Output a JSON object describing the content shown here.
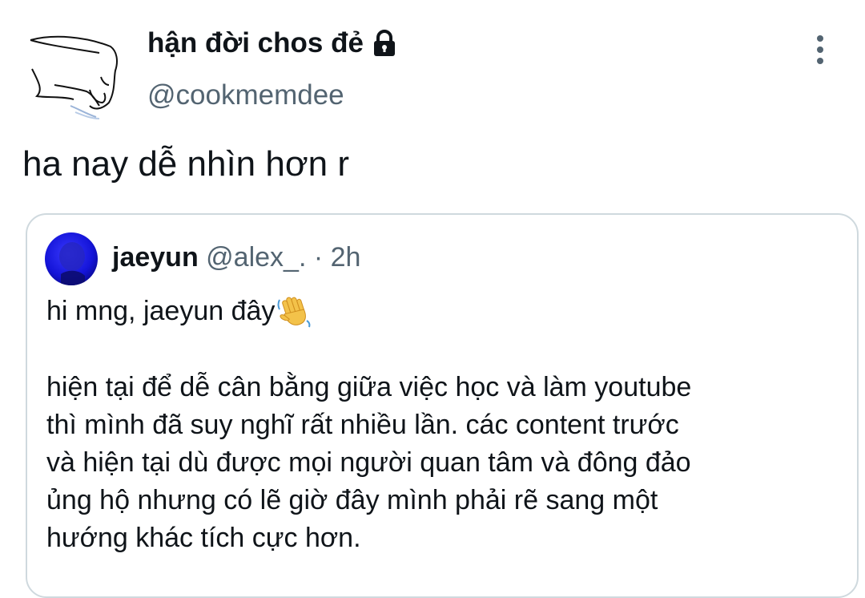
{
  "author": {
    "display_name": "hận đời chos đẻ",
    "handle": "@cookmemdee",
    "avatar_icon": "sketch-drawing-avatar",
    "protected_icon": "lock-icon"
  },
  "more_icon": "vertical-ellipsis-icon",
  "tweet": {
    "text": "ha nay dễ nhìn hơn r"
  },
  "quoted": {
    "name": "jaeyun",
    "meta": " @alex_. · 2h",
    "avatar_icon": "blue-photo-avatar",
    "greeting": "hi mng, jaeyun đây",
    "greeting_icon": "waving-hand-emoji",
    "body_lines": [
      "hiện tại để dễ cân bằng giữa việc học và làm youtube",
      "thì mình đã suy nghĩ rất nhiều lần. các content trước",
      "và hiện tại dù được mọi người quan tâm và đông đảo",
      "ủng hộ nhưng có lẽ giờ đây mình phải rẽ sang một",
      "hướng khác tích cực hơn."
    ]
  },
  "colors": {
    "text_primary": "#0f1419",
    "text_secondary": "#536471",
    "border": "#cfd9de",
    "quote_avatar": "#1a1adf"
  }
}
